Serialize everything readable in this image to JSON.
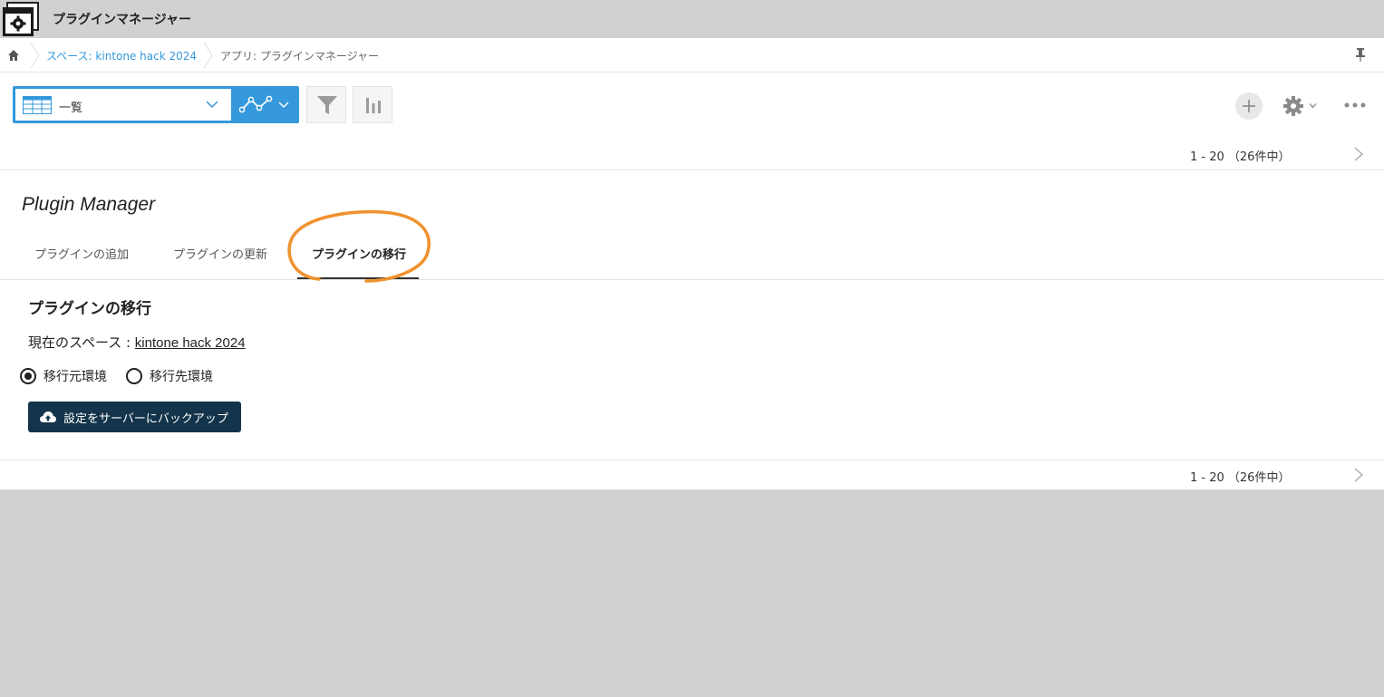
{
  "header": {
    "title": "プラグインマネージャー"
  },
  "breadcrumb": {
    "space": "スペース: kintone hack 2024",
    "app": "アプリ: プラグインマネージャー"
  },
  "toolbar": {
    "view_label": "一覧"
  },
  "pager": {
    "range": "1 - 20 （26件中）"
  },
  "plugin": {
    "title": "Plugin Manager",
    "tabs": [
      {
        "label": "プラグインの追加"
      },
      {
        "label": "プラグインの更新"
      },
      {
        "label": "プラグインの移行"
      }
    ],
    "section_title": "プラグインの移行",
    "space_prefix": "現在のスペース : ",
    "space_name": "kintone hack 2024",
    "radios": [
      {
        "label": "移行元環境",
        "checked": true
      },
      {
        "label": "移行先環境",
        "checked": false
      }
    ],
    "backup_button": "設定をサーバーにバックアップ"
  },
  "colors": {
    "accent": "#3498db",
    "button_dark": "#13344a",
    "highlight": "#f0912f"
  }
}
